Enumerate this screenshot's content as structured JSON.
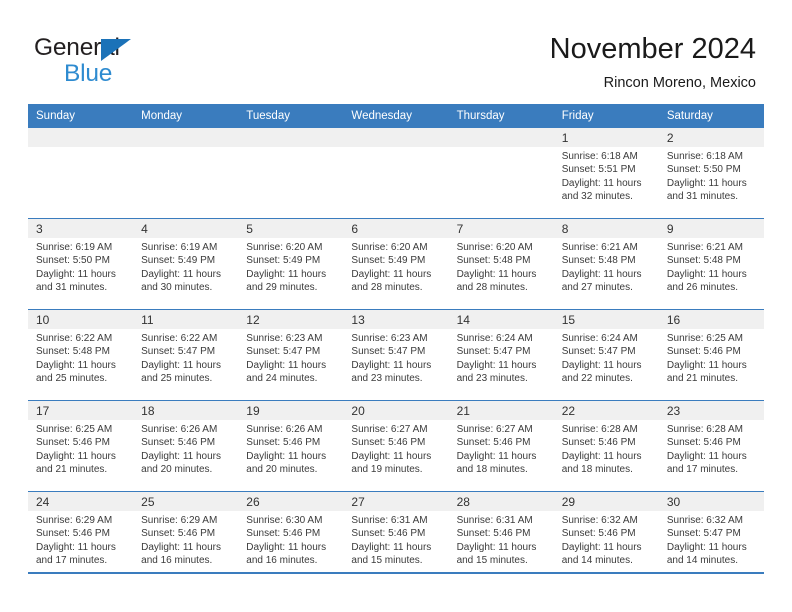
{
  "brand": {
    "name_part1": "General",
    "name_part2": "Blue",
    "triangle_icon": "triangle-icon",
    "accent_color": "#1b72b8",
    "blue_text_color": "#2e8bd0"
  },
  "header": {
    "title": "November 2024",
    "subtitle": "Rincon Moreno, Mexico"
  },
  "theme": {
    "header_row_bg": "#3a7cbe",
    "day_band_bg": "#f0f0f0",
    "cell_bg": "#ffffff",
    "rule_color": "#3a7cbe",
    "text_color": "#3b3b3b"
  },
  "weekdays": [
    "Sunday",
    "Monday",
    "Tuesday",
    "Wednesday",
    "Thursday",
    "Friday",
    "Saturday"
  ],
  "weeks": [
    [
      {
        "day": "",
        "empty": true
      },
      {
        "day": "",
        "empty": true
      },
      {
        "day": "",
        "empty": true
      },
      {
        "day": "",
        "empty": true
      },
      {
        "day": "",
        "empty": true
      },
      {
        "day": "1",
        "sunrise": "Sunrise: 6:18 AM",
        "sunset": "Sunset: 5:51 PM",
        "daylight_line1": "Daylight: 11 hours",
        "daylight_line2": "and 32 minutes."
      },
      {
        "day": "2",
        "sunrise": "Sunrise: 6:18 AM",
        "sunset": "Sunset: 5:50 PM",
        "daylight_line1": "Daylight: 11 hours",
        "daylight_line2": "and 31 minutes."
      }
    ],
    [
      {
        "day": "3",
        "sunrise": "Sunrise: 6:19 AM",
        "sunset": "Sunset: 5:50 PM",
        "daylight_line1": "Daylight: 11 hours",
        "daylight_line2": "and 31 minutes."
      },
      {
        "day": "4",
        "sunrise": "Sunrise: 6:19 AM",
        "sunset": "Sunset: 5:49 PM",
        "daylight_line1": "Daylight: 11 hours",
        "daylight_line2": "and 30 minutes."
      },
      {
        "day": "5",
        "sunrise": "Sunrise: 6:20 AM",
        "sunset": "Sunset: 5:49 PM",
        "daylight_line1": "Daylight: 11 hours",
        "daylight_line2": "and 29 minutes."
      },
      {
        "day": "6",
        "sunrise": "Sunrise: 6:20 AM",
        "sunset": "Sunset: 5:49 PM",
        "daylight_line1": "Daylight: 11 hours",
        "daylight_line2": "and 28 minutes."
      },
      {
        "day": "7",
        "sunrise": "Sunrise: 6:20 AM",
        "sunset": "Sunset: 5:48 PM",
        "daylight_line1": "Daylight: 11 hours",
        "daylight_line2": "and 28 minutes."
      },
      {
        "day": "8",
        "sunrise": "Sunrise: 6:21 AM",
        "sunset": "Sunset: 5:48 PM",
        "daylight_line1": "Daylight: 11 hours",
        "daylight_line2": "and 27 minutes."
      },
      {
        "day": "9",
        "sunrise": "Sunrise: 6:21 AM",
        "sunset": "Sunset: 5:48 PM",
        "daylight_line1": "Daylight: 11 hours",
        "daylight_line2": "and 26 minutes."
      }
    ],
    [
      {
        "day": "10",
        "sunrise": "Sunrise: 6:22 AM",
        "sunset": "Sunset: 5:48 PM",
        "daylight_line1": "Daylight: 11 hours",
        "daylight_line2": "and 25 minutes."
      },
      {
        "day": "11",
        "sunrise": "Sunrise: 6:22 AM",
        "sunset": "Sunset: 5:47 PM",
        "daylight_line1": "Daylight: 11 hours",
        "daylight_line2": "and 25 minutes."
      },
      {
        "day": "12",
        "sunrise": "Sunrise: 6:23 AM",
        "sunset": "Sunset: 5:47 PM",
        "daylight_line1": "Daylight: 11 hours",
        "daylight_line2": "and 24 minutes."
      },
      {
        "day": "13",
        "sunrise": "Sunrise: 6:23 AM",
        "sunset": "Sunset: 5:47 PM",
        "daylight_line1": "Daylight: 11 hours",
        "daylight_line2": "and 23 minutes."
      },
      {
        "day": "14",
        "sunrise": "Sunrise: 6:24 AM",
        "sunset": "Sunset: 5:47 PM",
        "daylight_line1": "Daylight: 11 hours",
        "daylight_line2": "and 23 minutes."
      },
      {
        "day": "15",
        "sunrise": "Sunrise: 6:24 AM",
        "sunset": "Sunset: 5:47 PM",
        "daylight_line1": "Daylight: 11 hours",
        "daylight_line2": "and 22 minutes."
      },
      {
        "day": "16",
        "sunrise": "Sunrise: 6:25 AM",
        "sunset": "Sunset: 5:46 PM",
        "daylight_line1": "Daylight: 11 hours",
        "daylight_line2": "and 21 minutes."
      }
    ],
    [
      {
        "day": "17",
        "sunrise": "Sunrise: 6:25 AM",
        "sunset": "Sunset: 5:46 PM",
        "daylight_line1": "Daylight: 11 hours",
        "daylight_line2": "and 21 minutes."
      },
      {
        "day": "18",
        "sunrise": "Sunrise: 6:26 AM",
        "sunset": "Sunset: 5:46 PM",
        "daylight_line1": "Daylight: 11 hours",
        "daylight_line2": "and 20 minutes."
      },
      {
        "day": "19",
        "sunrise": "Sunrise: 6:26 AM",
        "sunset": "Sunset: 5:46 PM",
        "daylight_line1": "Daylight: 11 hours",
        "daylight_line2": "and 20 minutes."
      },
      {
        "day": "20",
        "sunrise": "Sunrise: 6:27 AM",
        "sunset": "Sunset: 5:46 PM",
        "daylight_line1": "Daylight: 11 hours",
        "daylight_line2": "and 19 minutes."
      },
      {
        "day": "21",
        "sunrise": "Sunrise: 6:27 AM",
        "sunset": "Sunset: 5:46 PM",
        "daylight_line1": "Daylight: 11 hours",
        "daylight_line2": "and 18 minutes."
      },
      {
        "day": "22",
        "sunrise": "Sunrise: 6:28 AM",
        "sunset": "Sunset: 5:46 PM",
        "daylight_line1": "Daylight: 11 hours",
        "daylight_line2": "and 18 minutes."
      },
      {
        "day": "23",
        "sunrise": "Sunrise: 6:28 AM",
        "sunset": "Sunset: 5:46 PM",
        "daylight_line1": "Daylight: 11 hours",
        "daylight_line2": "and 17 minutes."
      }
    ],
    [
      {
        "day": "24",
        "sunrise": "Sunrise: 6:29 AM",
        "sunset": "Sunset: 5:46 PM",
        "daylight_line1": "Daylight: 11 hours",
        "daylight_line2": "and 17 minutes."
      },
      {
        "day": "25",
        "sunrise": "Sunrise: 6:29 AM",
        "sunset": "Sunset: 5:46 PM",
        "daylight_line1": "Daylight: 11 hours",
        "daylight_line2": "and 16 minutes."
      },
      {
        "day": "26",
        "sunrise": "Sunrise: 6:30 AM",
        "sunset": "Sunset: 5:46 PM",
        "daylight_line1": "Daylight: 11 hours",
        "daylight_line2": "and 16 minutes."
      },
      {
        "day": "27",
        "sunrise": "Sunrise: 6:31 AM",
        "sunset": "Sunset: 5:46 PM",
        "daylight_line1": "Daylight: 11 hours",
        "daylight_line2": "and 15 minutes."
      },
      {
        "day": "28",
        "sunrise": "Sunrise: 6:31 AM",
        "sunset": "Sunset: 5:46 PM",
        "daylight_line1": "Daylight: 11 hours",
        "daylight_line2": "and 15 minutes."
      },
      {
        "day": "29",
        "sunrise": "Sunrise: 6:32 AM",
        "sunset": "Sunset: 5:46 PM",
        "daylight_line1": "Daylight: 11 hours",
        "daylight_line2": "and 14 minutes."
      },
      {
        "day": "30",
        "sunrise": "Sunrise: 6:32 AM",
        "sunset": "Sunset: 5:47 PM",
        "daylight_line1": "Daylight: 11 hours",
        "daylight_line2": "and 14 minutes."
      }
    ]
  ]
}
